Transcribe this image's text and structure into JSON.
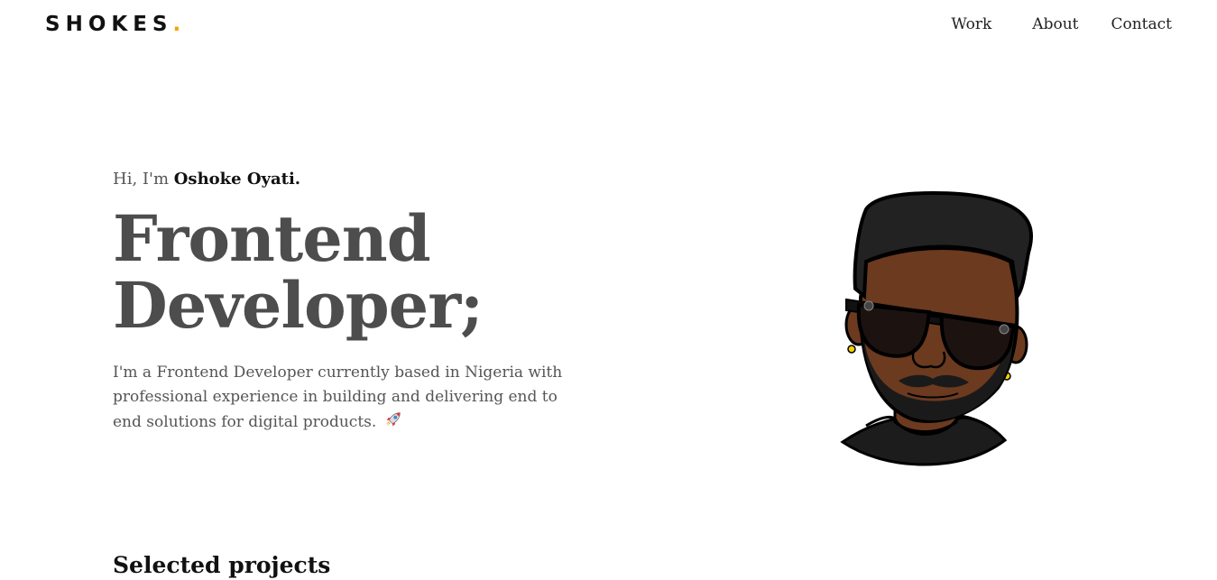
{
  "brand": {
    "name": "SHOKES",
    "dot": ".",
    "accent_color": "#f5a400"
  },
  "nav": {
    "items": [
      {
        "label": "Work"
      },
      {
        "label": "About"
      },
      {
        "label": "Contact"
      }
    ]
  },
  "hero": {
    "greeting_prefix": "Hi, I'm ",
    "greeting_name": "Oshoke Oyati.",
    "headline_line1": "Frontend",
    "headline_line2": "Developer;",
    "intro": "I'm a Frontend Developer currently based in Nigeria with professional experience in building and delivering end to end solutions for digital products.",
    "intro_icon": "rocket-icon",
    "avatar_icon": "avatar-illustration"
  },
  "sections": {
    "selected_projects": "Selected projects"
  }
}
